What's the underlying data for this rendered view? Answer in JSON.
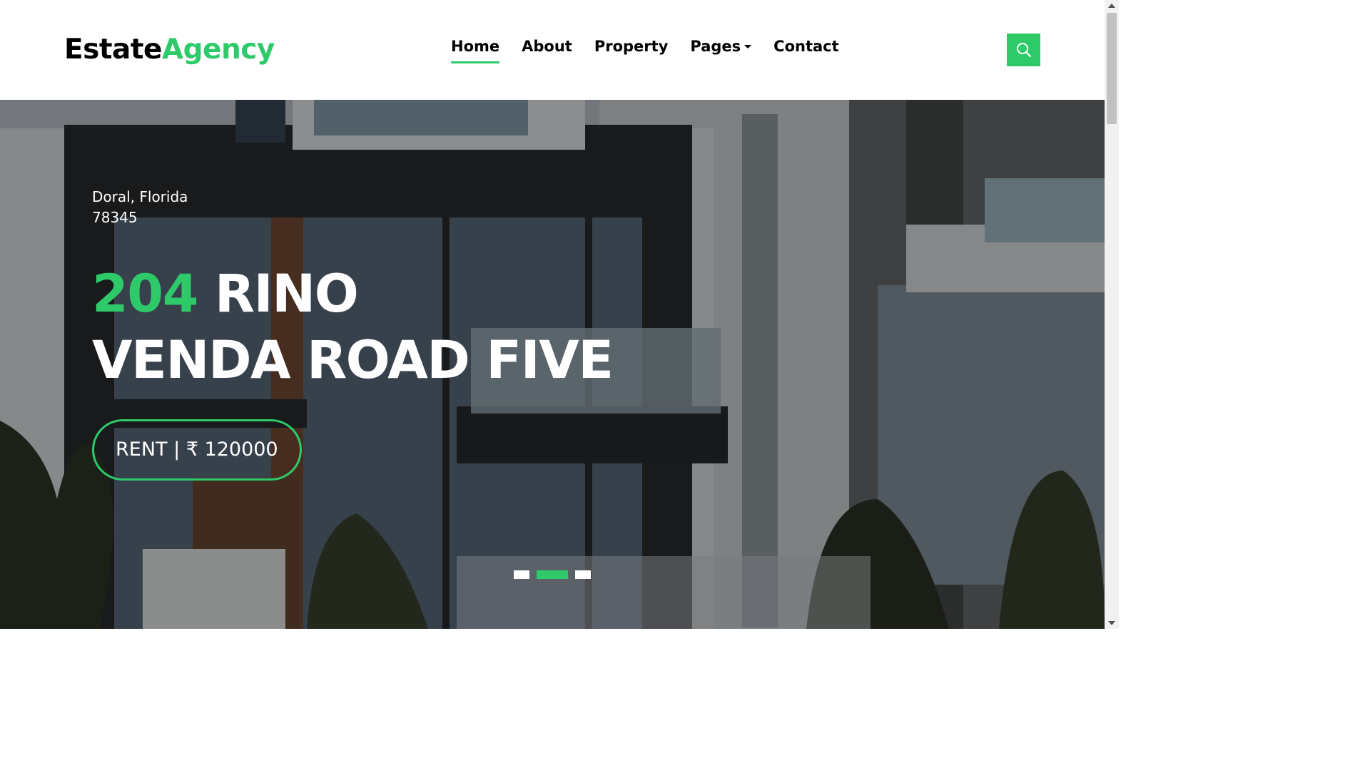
{
  "brand": {
    "part1": "Estate",
    "part2": "Agency"
  },
  "nav": {
    "items": [
      {
        "label": "Home"
      },
      {
        "label": "About"
      },
      {
        "label": "Property"
      },
      {
        "label": "Pages"
      },
      {
        "label": "Contact"
      }
    ],
    "active": "Home"
  },
  "search": {
    "icon": "search-icon"
  },
  "hero": {
    "location_line1": "Doral, Florida",
    "location_line2": "78345",
    "title_number": "204",
    "title_rest_line1": "Rino",
    "title_line2": "Venda Road Five",
    "price_label": "RENT | ₹ 120000"
  },
  "carousel": {
    "slides": 3,
    "active_index": 1
  },
  "colors": {
    "accent": "#2eca6a",
    "text": "#000000",
    "hero_text": "#ffffff"
  }
}
